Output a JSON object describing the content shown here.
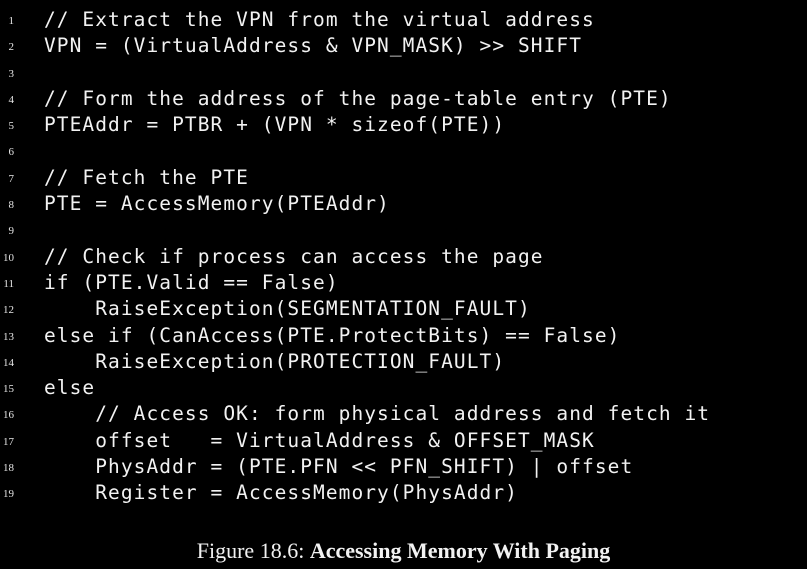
{
  "code_lines": [
    {
      "number": "1",
      "text": "// Extract the VPN from the virtual address"
    },
    {
      "number": "2",
      "text": "VPN = (VirtualAddress & VPN_MASK) >> SHIFT"
    },
    {
      "number": "3",
      "text": ""
    },
    {
      "number": "4",
      "text": "// Form the address of the page-table entry (PTE)"
    },
    {
      "number": "5",
      "text": "PTEAddr = PTBR + (VPN * sizeof(PTE))"
    },
    {
      "number": "6",
      "text": ""
    },
    {
      "number": "7",
      "text": "// Fetch the PTE"
    },
    {
      "number": "8",
      "text": "PTE = AccessMemory(PTEAddr)"
    },
    {
      "number": "9",
      "text": ""
    },
    {
      "number": "10",
      "text": "// Check if process can access the page"
    },
    {
      "number": "11",
      "text": "if (PTE.Valid == False)"
    },
    {
      "number": "12",
      "text": "    RaiseException(SEGMENTATION_FAULT)"
    },
    {
      "number": "13",
      "text": "else if (CanAccess(PTE.ProtectBits) == False)"
    },
    {
      "number": "14",
      "text": "    RaiseException(PROTECTION_FAULT)"
    },
    {
      "number": "15",
      "text": "else"
    },
    {
      "number": "16",
      "text": "    // Access OK: form physical address and fetch it"
    },
    {
      "number": "17",
      "text": "    offset   = VirtualAddress & OFFSET_MASK"
    },
    {
      "number": "18",
      "text": "    PhysAddr = (PTE.PFN << PFN_SHIFT) | offset"
    },
    {
      "number": "19",
      "text": "    Register = AccessMemory(PhysAddr)"
    }
  ],
  "caption": {
    "label": "Figure 18.6: ",
    "title": "Accessing Memory With Paging"
  }
}
